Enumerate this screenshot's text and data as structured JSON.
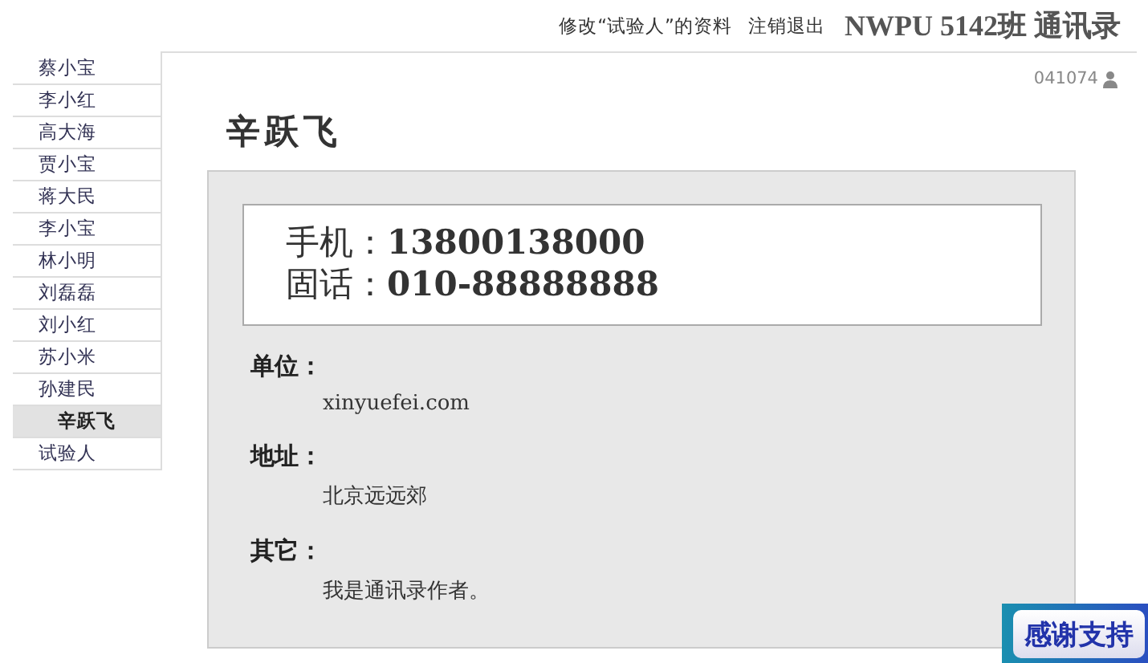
{
  "header": {
    "links": [
      {
        "label": "修改“试验人”的资料"
      },
      {
        "label": "注销退出"
      }
    ],
    "title": "NWPU 5142班 通讯录"
  },
  "sidebar": {
    "items": [
      {
        "label": "蔡小宝",
        "selected": false
      },
      {
        "label": "李小红",
        "selected": false
      },
      {
        "label": "高大海",
        "selected": false
      },
      {
        "label": "贾小宝",
        "selected": false
      },
      {
        "label": "蒋大民",
        "selected": false
      },
      {
        "label": "李小宝",
        "selected": false
      },
      {
        "label": "林小明",
        "selected": false
      },
      {
        "label": "刘磊磊",
        "selected": false
      },
      {
        "label": "刘小红",
        "selected": false
      },
      {
        "label": "苏小米",
        "selected": false
      },
      {
        "label": "孙建民",
        "selected": false
      },
      {
        "label": "辛跃飞",
        "selected": true
      },
      {
        "label": "试验人",
        "selected": false
      }
    ]
  },
  "user": {
    "id": "041074"
  },
  "contact": {
    "name": "辛跃飞",
    "phones": [
      {
        "label": "手机：",
        "value": "13800138000"
      },
      {
        "label": "固话：",
        "value": "010-88888888"
      }
    ],
    "sections": [
      {
        "label": "单位：",
        "value": "xinyuefei.com"
      },
      {
        "label": "地址：",
        "value": "北京远远郊"
      },
      {
        "label": "其它：",
        "value": "我是通讯录作者。"
      }
    ]
  },
  "support_badge": {
    "label": "感谢支持"
  }
}
